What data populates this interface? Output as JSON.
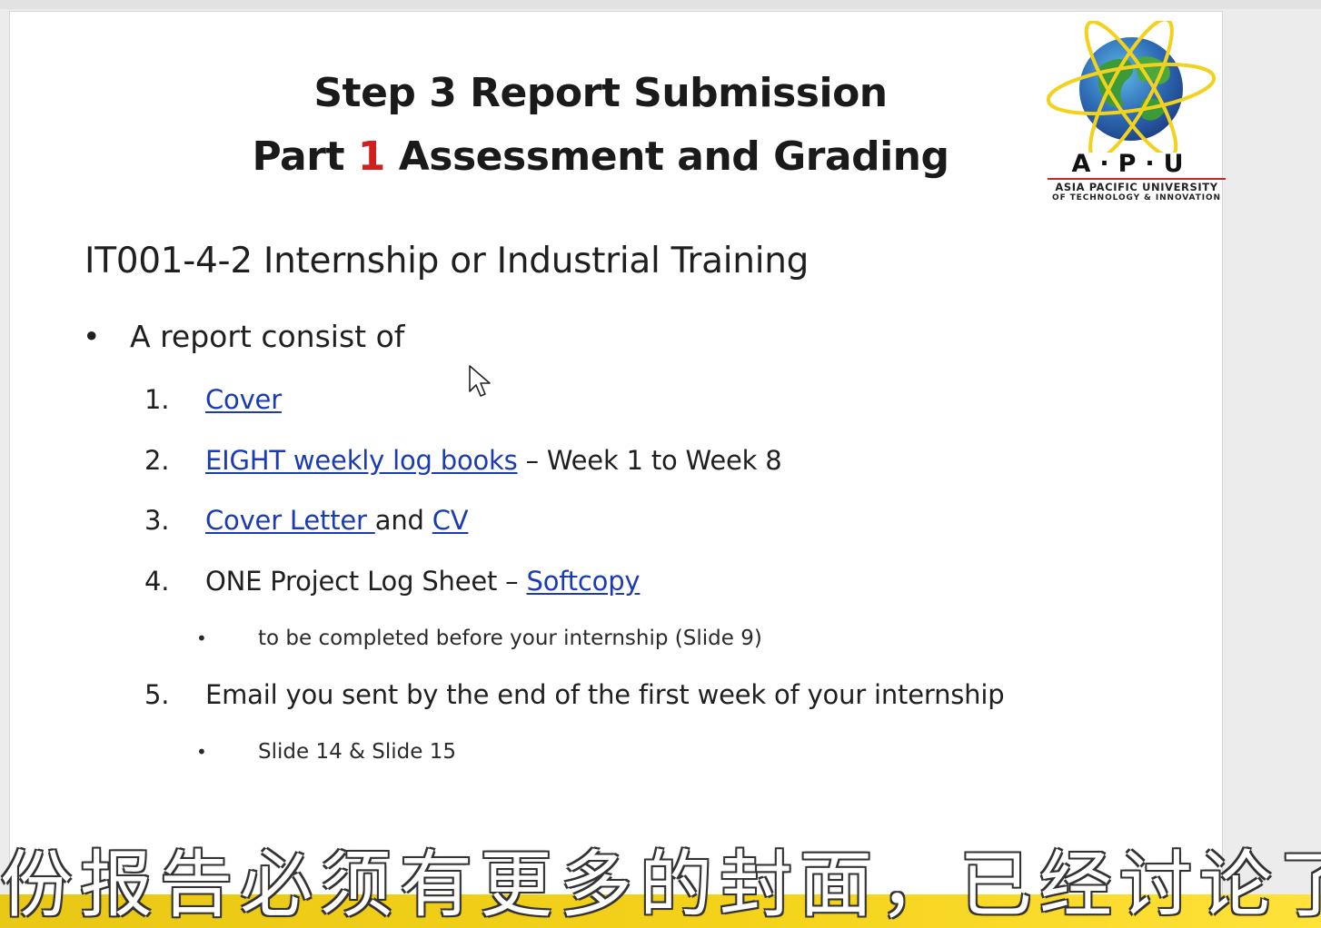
{
  "slide": {
    "title_line1": "Step 3 Report Submission",
    "title_line2_prefix": "Part ",
    "title_line2_number": "1",
    "title_line2_suffix": " Assessment and Grading",
    "subtitle": "IT001-4-2 Internship or Industrial Training",
    "intro_bullet": "A report consist of",
    "items": [
      {
        "num": "1.",
        "link": "Cover"
      },
      {
        "num": "2.",
        "link": "EIGHT weekly log books",
        "text": " – Week 1 to Week 8"
      },
      {
        "num": "3.",
        "link": "Cover Letter ",
        "text": "and ",
        "link2": "CV"
      },
      {
        "num": "4.",
        "text": "ONE Project Log Sheet – ",
        "link": "Softcopy"
      },
      {
        "num": "5.",
        "text": "Email you sent by the end of the first week of your internship"
      }
    ],
    "sub_bullets": [
      "to be completed before your internship (Slide 9)",
      "Slide 14 & Slide 15"
    ]
  },
  "logo": {
    "brand": "A·P·U",
    "line1": "ASIA PACIFIC UNIVERSITY",
    "line2": "OF TECHNOLOGY & INNOVATION"
  },
  "caption": {
    "text": "份报告必须有更多的封面，已经讨论了在"
  },
  "colors": {
    "link": "#1a3bb4",
    "accent_red": "#d0201d",
    "caption_band": "#f4d21a"
  },
  "icons": [
    "mouse-cursor-icon",
    "apu-globe-logo-icon"
  ]
}
